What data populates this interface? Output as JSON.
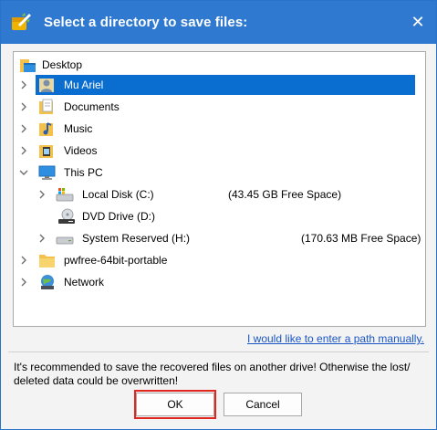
{
  "dialog": {
    "title": "Select a directory to save files:",
    "close_glyph": "✕"
  },
  "tree": {
    "items": [
      {
        "label": "Desktop",
        "icon": "desktop-folder-icon"
      },
      {
        "label": "Mu Ariel",
        "icon": "user-folder-icon",
        "selected": true
      },
      {
        "label": "Documents",
        "icon": "documents-icon"
      },
      {
        "label": "Music",
        "icon": "music-icon"
      },
      {
        "label": "Videos",
        "icon": "videos-icon"
      },
      {
        "label": "This PC",
        "icon": "computer-icon",
        "expanded": true
      },
      {
        "label": "Local Disk (C:)",
        "icon": "local-disk-icon",
        "free": "(43.45 GB Free Space)"
      },
      {
        "label": "DVD Drive (D:)",
        "icon": "dvd-drive-icon"
      },
      {
        "label": "System Reserved (H:)",
        "icon": "drive-icon",
        "free": "(170.63 MB Free Space)"
      },
      {
        "label": "pwfree-64bit-portable",
        "icon": "folder-icon"
      },
      {
        "label": "Network",
        "icon": "network-icon"
      }
    ]
  },
  "manual_path_link": "I would like to enter a path manually.",
  "notice": "It's recommended to save the recovered files on another drive! Otherwise the lost/ deleted data could be overwritten!",
  "buttons": {
    "ok": "OK",
    "cancel": "Cancel"
  },
  "colors": {
    "titlebar": "#2f79d1",
    "selection": "#0a6ed1",
    "highlight": "#e0261f",
    "link": "#1a56c4"
  }
}
